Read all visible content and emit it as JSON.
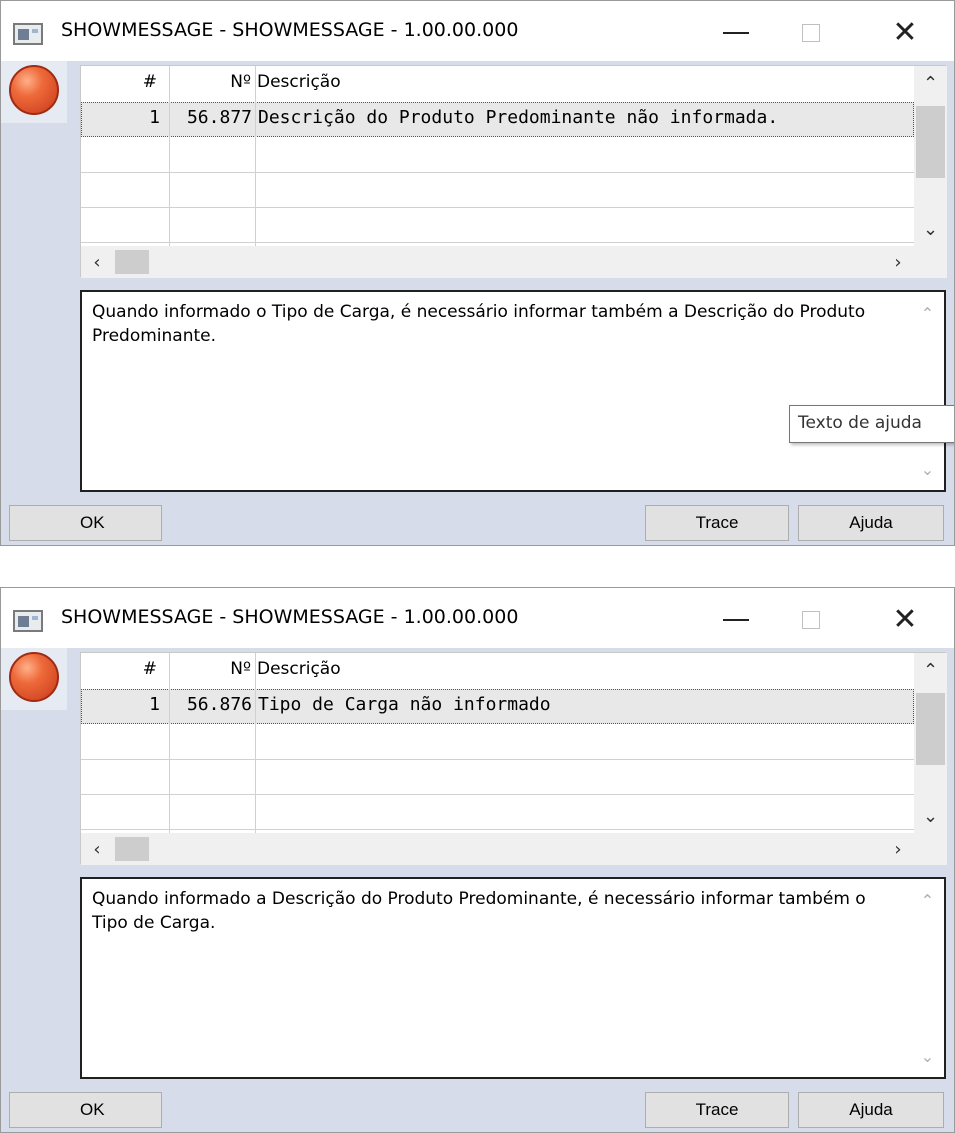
{
  "windows": [
    {
      "title": "SHOWMESSAGE - SHOWMESSAGE - 1.00.00.000",
      "grid": {
        "columns": [
          "#",
          "Nº",
          "Descrição"
        ],
        "rows": [
          {
            "index": "1",
            "number": "56.877",
            "description": "Descrição do Produto Predominante não informada."
          }
        ]
      },
      "detail_text": "Quando informado o Tipo de Carga, é necessário informar também a Descrição do Produto Predominante.",
      "tooltip": "Texto de ajuda",
      "buttons": {
        "ok": "OK",
        "trace": "Trace",
        "help": "Ajuda"
      }
    },
    {
      "title": "SHOWMESSAGE - SHOWMESSAGE - 1.00.00.000",
      "grid": {
        "columns": [
          "#",
          "Nº",
          "Descrição"
        ],
        "rows": [
          {
            "index": "1",
            "number": "56.876",
            "description": "Tipo de Carga não informado"
          }
        ]
      },
      "detail_text": "Quando informado a Descrição do Produto Predominante, é necessário informar também o Tipo de Carga.",
      "buttons": {
        "ok": "OK",
        "trace": "Trace",
        "help": "Ajuda"
      }
    }
  ],
  "icons": {
    "app": "app-window-icon",
    "severity": "stop-error-icon",
    "minimize": "minimize-icon",
    "maximize": "maximize-icon",
    "close": "close-icon"
  },
  "colors": {
    "panel_background": "#d6dcea",
    "stop_icon": "#e0542a"
  }
}
